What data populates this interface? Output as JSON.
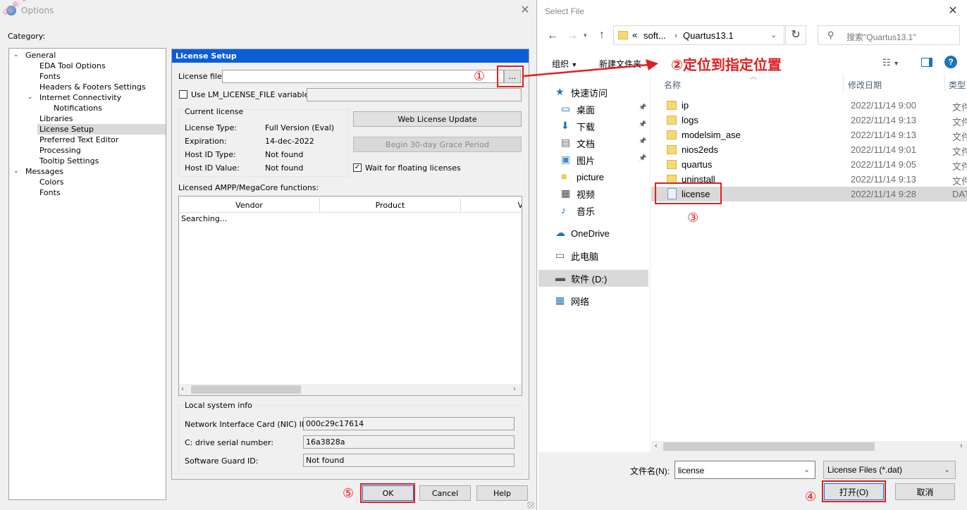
{
  "options": {
    "title": "Options",
    "watermark": "公众号: 软件科技",
    "category_label": "Category:",
    "tree": [
      {
        "label": "General",
        "level": 0,
        "toggle": "expanded"
      },
      {
        "label": "EDA Tool Options",
        "level": 1
      },
      {
        "label": "Fonts",
        "level": 1
      },
      {
        "label": "Headers & Footers Settings",
        "level": 1
      },
      {
        "label": "Internet Connectivity",
        "level": 1,
        "toggle": "expanded"
      },
      {
        "label": "Notifications",
        "level": 2
      },
      {
        "label": "Libraries",
        "level": 1
      },
      {
        "label": "License Setup",
        "level": 1,
        "selected": true
      },
      {
        "label": "Preferred Text Editor",
        "level": 1
      },
      {
        "label": "Processing",
        "level": 1
      },
      {
        "label": "Tooltip Settings",
        "level": 1
      },
      {
        "label": "Messages",
        "level": 0,
        "toggle": "expanded"
      },
      {
        "label": "Colors",
        "level": 1
      },
      {
        "label": "Fonts",
        "level": 1
      }
    ],
    "panel_title": "License Setup",
    "license_file_label": "License file:",
    "license_file_value": "",
    "browse_label": "...",
    "use_env_label": "Use LM_LICENSE_FILE variable:",
    "use_env_checked": false,
    "current_license": {
      "legend": "Current license",
      "rows": [
        {
          "label": "License Type:",
          "value": "Full Version (Eval)"
        },
        {
          "label": "Expiration:",
          "value": "14-dec-2022"
        },
        {
          "label": "Host ID Type:",
          "value": "Not found"
        },
        {
          "label": "Host ID Value:",
          "value": "Not found"
        }
      ]
    },
    "web_update_label": "Web License Update",
    "grace_label": "Begin 30-day Grace Period",
    "wait_label": "Wait for floating licenses",
    "wait_checked": true,
    "ampp_label": "Licensed AMPP/MegaCore functions:",
    "ampp_columns": [
      "Vendor",
      "Product",
      "V"
    ],
    "ampp_status": "Searching...",
    "local_info": {
      "legend": "Local system info",
      "nic_label": "Network Interface Card (NIC) ID:",
      "nic_value": "000c29c17614",
      "drive_label": "C: drive serial number:",
      "drive_value": "16a3828a",
      "guard_label": "Software Guard ID:",
      "guard_value": "Not found"
    },
    "ok_label": "OK",
    "cancel_label": "Cancel",
    "help_label": "Help"
  },
  "annotations": {
    "n1": "①",
    "n2": "②定位到指定位置",
    "n3": "③",
    "n4": "④",
    "n5": "⑤",
    "color": "#e02020"
  },
  "select_file": {
    "title": "Select File",
    "path_prefix": "«",
    "path_parts": [
      "soft...",
      "Quartus13.1"
    ],
    "search_placeholder": "搜索\"Quartus13.1\"",
    "organize_label": "组织",
    "new_folder_label": "新建文件夹",
    "nav": [
      {
        "label": "快速访问",
        "icon": "star-icon"
      },
      {
        "label": "桌面",
        "icon": "desktop-icon",
        "pinned": true
      },
      {
        "label": "下载",
        "icon": "download-icon",
        "pinned": true
      },
      {
        "label": "文档",
        "icon": "document-icon",
        "pinned": true
      },
      {
        "label": "图片",
        "icon": "picture-icon",
        "pinned": true
      },
      {
        "label": "picture",
        "icon": "folder-icon"
      },
      {
        "label": "视频",
        "icon": "video-icon"
      },
      {
        "label": "音乐",
        "icon": "music-icon"
      },
      {
        "label": "OneDrive",
        "icon": "cloud-icon"
      },
      {
        "label": "此电脑",
        "icon": "computer-icon"
      },
      {
        "label": "软件 (D:)",
        "icon": "drive-icon",
        "selected": true
      },
      {
        "label": "网络",
        "icon": "network-icon"
      }
    ],
    "columns": {
      "name": "名称",
      "date": "修改日期",
      "type": "类型"
    },
    "files": [
      {
        "name": "ip",
        "date": "2022/11/14 9:00",
        "type": "文件",
        "kind": "folder"
      },
      {
        "name": "logs",
        "date": "2022/11/14 9:13",
        "type": "文件",
        "kind": "folder"
      },
      {
        "name": "modelsim_ase",
        "date": "2022/11/14 9:13",
        "type": "文件",
        "kind": "folder"
      },
      {
        "name": "nios2eds",
        "date": "2022/11/14 9:01",
        "type": "文件",
        "kind": "folder"
      },
      {
        "name": "quartus",
        "date": "2022/11/14 9:05",
        "type": "文件",
        "kind": "folder"
      },
      {
        "name": "uninstall",
        "date": "2022/11/14 9:13",
        "type": "文件",
        "kind": "folder"
      },
      {
        "name": "license",
        "date": "2022/11/14 9:28",
        "type": "DAT",
        "kind": "file",
        "selected": true
      }
    ],
    "filename_label": "文件名(N):",
    "filename_value": "license",
    "filter_value": "License Files (*.dat)",
    "open_label": "打开(O)",
    "cancel_label": "取消"
  }
}
